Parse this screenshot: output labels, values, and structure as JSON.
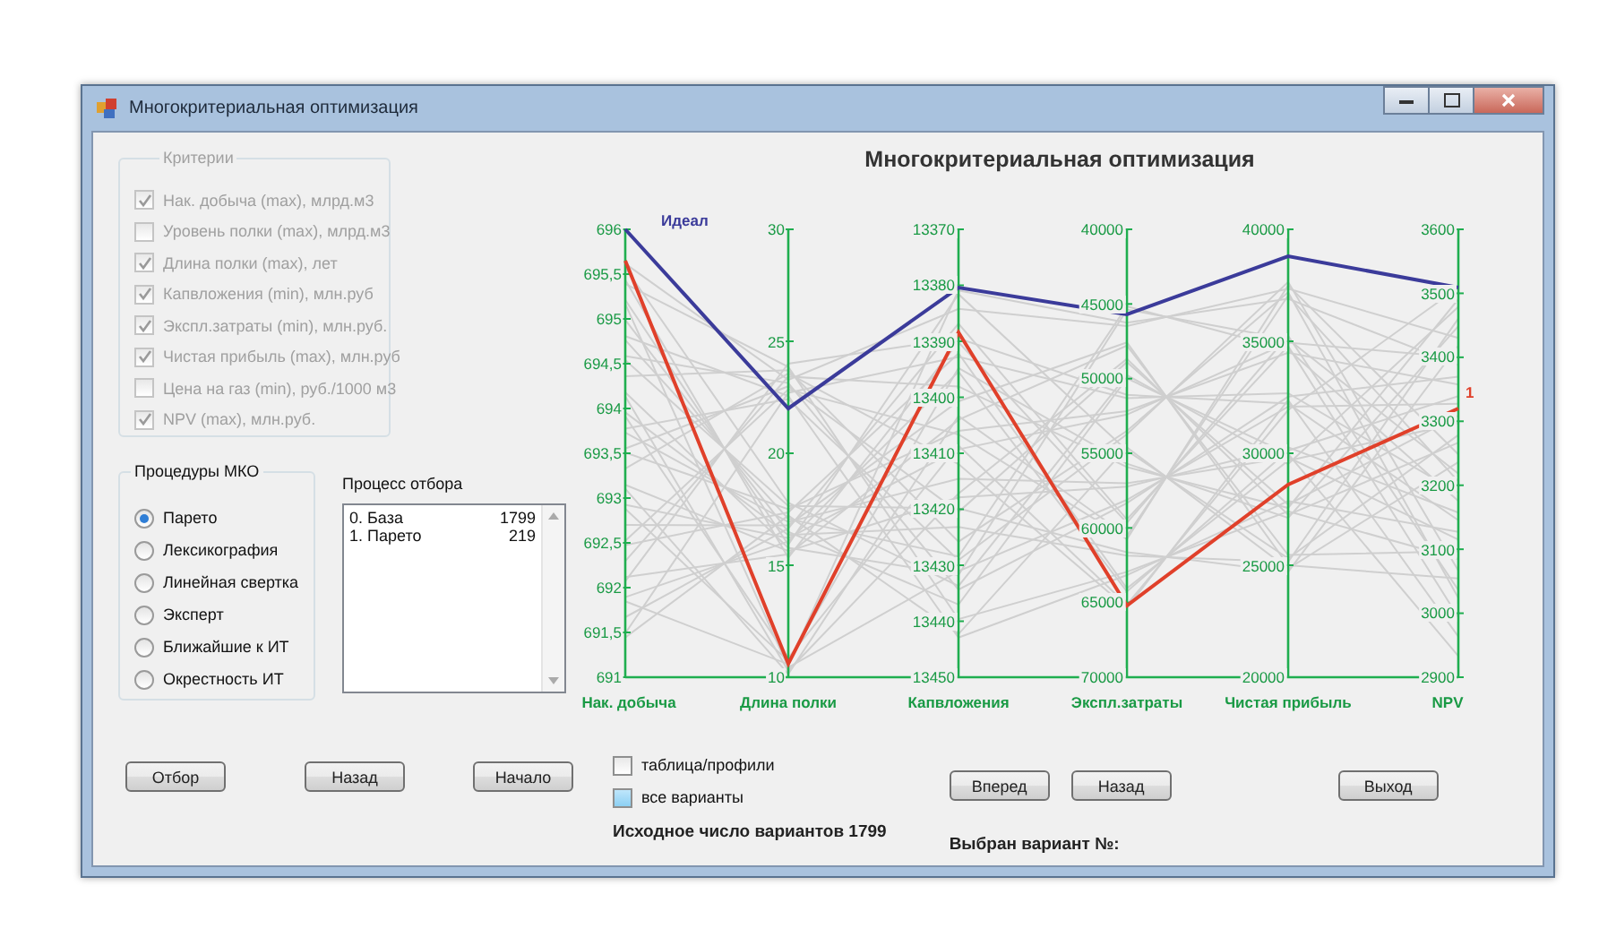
{
  "window": {
    "title": "Многокритериальная оптимизация"
  },
  "criteria": {
    "title": "Критерии",
    "disabled": true,
    "items": [
      {
        "label": "Нак. добыча (max), млрд.м3",
        "checked": true
      },
      {
        "label": "Уровень полки (max), млрд.м3",
        "checked": false
      },
      {
        "label": "Длина полки (max), лет",
        "checked": true
      },
      {
        "label": "Капвложения (min), млн.руб",
        "checked": true
      },
      {
        "label": "Экспл.затраты  (min), млн.руб.",
        "checked": true
      },
      {
        "label": "Чистая прибыль (max), млн.руб",
        "checked": true
      },
      {
        "label": "Цена на газ (min), руб./1000 м3",
        "checked": false
      },
      {
        "label": "NPV (max), млн.руб.",
        "checked": true
      }
    ]
  },
  "procedures": {
    "title": "Процедуры МКО",
    "items": [
      {
        "label": "Парето",
        "selected": true
      },
      {
        "label": "Лексикография",
        "selected": false
      },
      {
        "label": "Линейная свертка",
        "selected": false
      },
      {
        "label": "Эксперт",
        "selected": false
      },
      {
        "label": "Ближайшие к ИТ",
        "selected": false
      },
      {
        "label": "Окрестность ИТ",
        "selected": false
      }
    ]
  },
  "selection_process": {
    "title": "Процесс отбора",
    "rows": [
      {
        "name": "0. База",
        "count": "1799"
      },
      {
        "name": "1. Парето",
        "count": "219"
      }
    ]
  },
  "left_buttons": [
    "Отбор",
    "Назад",
    "Начало"
  ],
  "options": [
    {
      "label": "таблица/профили",
      "checked": false,
      "highlighted": false
    },
    {
      "label": "все варианты",
      "checked": false,
      "highlighted": true
    }
  ],
  "initial_count": "Исходное число вариантов 1799",
  "nav_buttons": [
    "Вперед",
    "Назад"
  ],
  "selected_variant": "Выбран вариант №:",
  "exit_button": "Выход",
  "chart": {
    "title": "Многокритериальная оптимизация",
    "ideal_label": "Идеал",
    "selected_label": "1",
    "axes": [
      {
        "name": "Нак. добыча",
        "ticks": [
          "696",
          "695,5",
          "695",
          "694,5",
          "694",
          "693,5",
          "693",
          "692,5",
          "692",
          "691,5",
          "691"
        ]
      },
      {
        "name": "Длина полки",
        "ticks": [
          "30",
          "25",
          "20",
          "15",
          "10"
        ]
      },
      {
        "name": "Капвложения",
        "ticks": [
          "13370",
          "13380",
          "13390",
          "13400",
          "13410",
          "13420",
          "13430",
          "13440",
          "13450"
        ]
      },
      {
        "name": "Экспл.затраты",
        "ticks": [
          "40000",
          "45000",
          "50000",
          "55000",
          "60000",
          "65000",
          "70000"
        ]
      },
      {
        "name": "Чистая прибыль",
        "ticks": [
          "40000",
          "35000",
          "30000",
          "25000",
          "20000"
        ]
      },
      {
        "name": "NPV",
        "ticks": [
          "3600",
          "3500",
          "3400",
          "3300",
          "3200",
          "3100",
          "3000",
          "2900"
        ]
      }
    ]
  }
}
